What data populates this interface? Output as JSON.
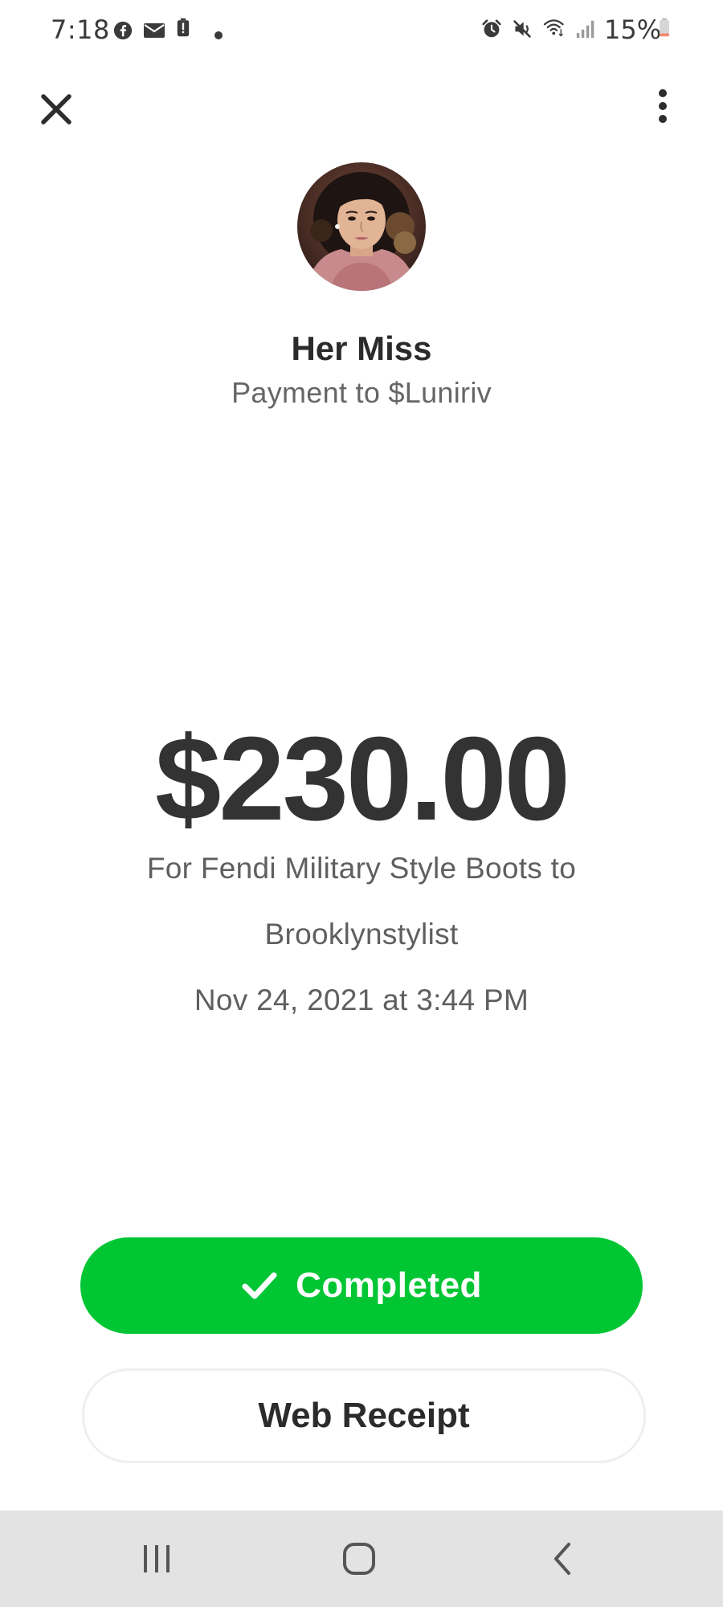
{
  "status_bar": {
    "time": "7:18",
    "battery_percent": "15%",
    "notification_icons": [
      "facebook-icon",
      "mail-icon",
      "battery-alert-icon",
      "dot-icon"
    ],
    "system_icons": [
      "alarm-icon",
      "mute-icon",
      "wifi-icon",
      "signal-icon",
      "battery-icon"
    ]
  },
  "header": {
    "close_icon": "close-icon",
    "menu_icon": "more-vertical-icon"
  },
  "recipient": {
    "name": "Her Miss",
    "subtitle": "Payment to $Luniriv"
  },
  "payment": {
    "amount": "$230.00",
    "note_line_1": "For Fendi Military Style Boots to",
    "note_line_2": "Brooklynstylist",
    "date": "Nov 24, 2021 at 3:44 PM"
  },
  "actions": {
    "status_label": "Completed",
    "status_icon": "check-icon",
    "receipt_label": "Web Receipt"
  },
  "colors": {
    "accent_green": "#00c634",
    "text_dark": "#333333",
    "text_muted": "#666666",
    "nav_bar_bg": "#e3e3e3"
  },
  "nav_bar": {
    "icons": [
      "recent-apps-icon",
      "home-icon",
      "back-icon"
    ]
  }
}
